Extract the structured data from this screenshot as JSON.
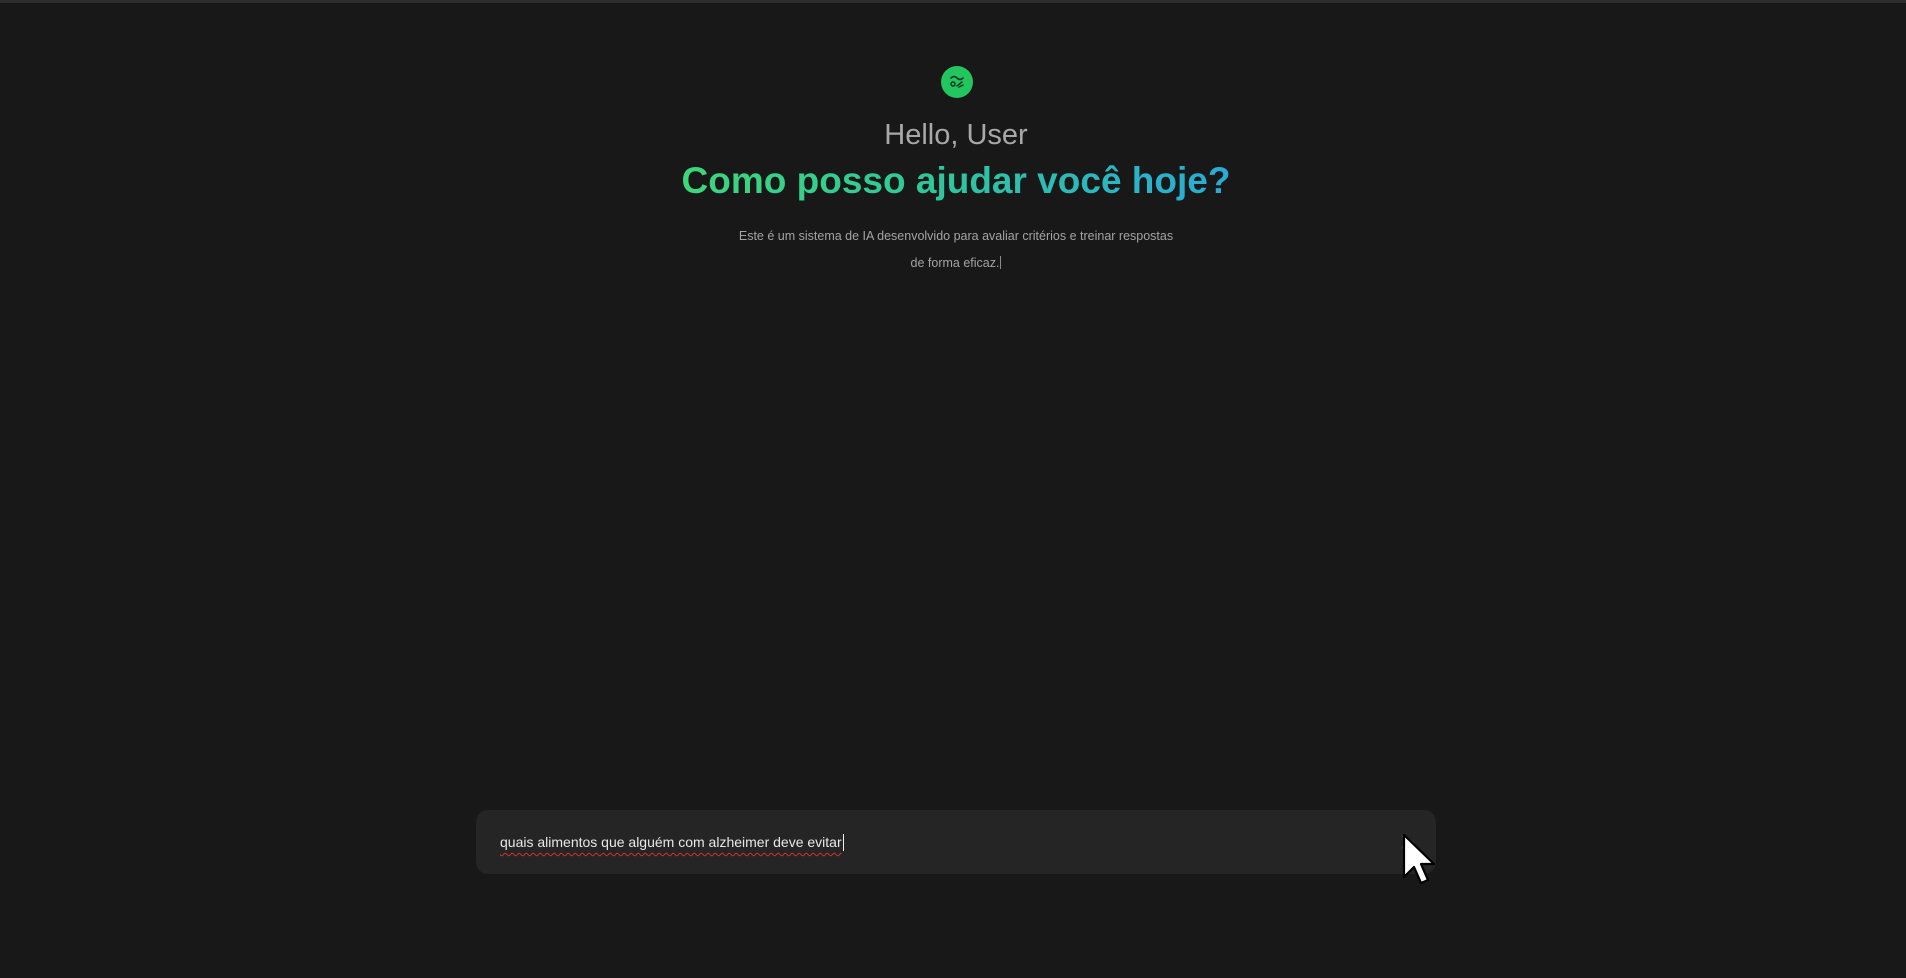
{
  "header": {
    "logo_icon": "sparkle-logo-icon",
    "greeting": "Hello, User",
    "headline": "Como posso ajudar você hoje?",
    "description_line1": "Este é um sistema de IA desenvolvido para avaliar critérios e treinar respostas",
    "description_line2": "de forma eficaz."
  },
  "chat_input": {
    "value": "quais alimentos que alguém com alzheimer deve evitar",
    "send_icon": "send-icon"
  },
  "colors": {
    "background": "#181818",
    "accent_green": "#22c55e",
    "gradient_start": "#3ed67a",
    "gradient_end": "#2aaad8",
    "input_background": "#252525"
  }
}
